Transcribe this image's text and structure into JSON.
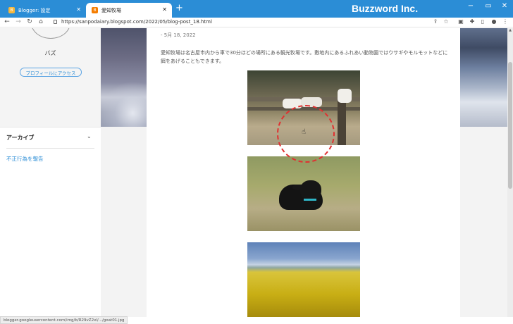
{
  "browser": {
    "tabs": [
      {
        "title": "Blogger: 設定",
        "active": false
      },
      {
        "title": "愛知牧場",
        "active": true
      }
    ],
    "new_tab": "+",
    "brand": "Buzzword Inc.",
    "window_controls": {
      "minimize": "−",
      "restore": "▭",
      "close": "✕"
    },
    "address": "https://sanpodaiary.blogspot.com/2022/05/blog-post_18.html",
    "status_url": "blogger.googleusercontent.com/img/b/R29vZ2xl/.../goat01.jpg"
  },
  "sidebar": {
    "profile_name": "バズ",
    "profile_button": "プロフィールにアクセス",
    "archive_label": "アーカイブ",
    "report_link": "不正行為を報告"
  },
  "post": {
    "date": "- 5月 18, 2022",
    "body": "愛知牧場は名古屋市内から車で30分ほどの場所にある観光牧場です。敷地内にあるふれあい動物園ではウサギやモルモットなどに餌をあげることもできます。",
    "images": [
      {
        "name": "goats-photo"
      },
      {
        "name": "black-lamb-photo"
      },
      {
        "name": "rapeseed-field-photo"
      }
    ]
  },
  "colors": {
    "titlebar": "#2b8dd6",
    "link": "#2b8dd6",
    "highlight_circle": "#e03131"
  },
  "icons": {
    "back": "back-arrow-icon",
    "forward": "forward-arrow-icon",
    "reload": "reload-icon",
    "home": "home-icon",
    "lock": "lock-icon",
    "share": "share-icon",
    "bookmark": "star-icon",
    "extensions": "puzzle-icon",
    "profile": "person-icon",
    "menu": "kebab-menu-icon"
  }
}
